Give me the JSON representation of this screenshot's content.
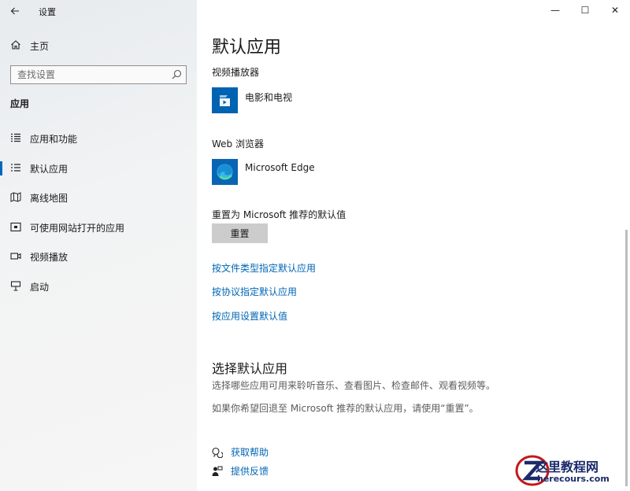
{
  "window": {
    "title": "设置",
    "back_icon": "arrow-left",
    "minimize_glyph": "—",
    "maximize_glyph": "☐",
    "close_glyph": "✕"
  },
  "sidebar": {
    "home_label": "主页",
    "search_placeholder": "查找设置",
    "section_header": "应用",
    "items": [
      {
        "label": "应用和功能",
        "icon": "apps-list-icon",
        "active": false
      },
      {
        "label": "默认应用",
        "icon": "default-apps-icon",
        "active": true
      },
      {
        "label": "离线地图",
        "icon": "map-icon",
        "active": false
      },
      {
        "label": "可使用网站打开的应用",
        "icon": "website-app-icon",
        "active": false
      },
      {
        "label": "视频播放",
        "icon": "video-icon",
        "active": false
      },
      {
        "label": "启动",
        "icon": "startup-icon",
        "active": false
      }
    ]
  },
  "main": {
    "page_title": "默认应用",
    "video_player_label": "视频播放器",
    "video_app_name": "电影和电视",
    "browser_label": "Web 浏览器",
    "browser_app_name": "Microsoft Edge",
    "reset_label": "重置为 Microsoft 推荐的默认值",
    "reset_button": "重置",
    "links": [
      "按文件类型指定默认应用",
      "按协议指定默认应用",
      "按应用设置默认值"
    ],
    "choose_title": "选择默认应用",
    "choose_desc1": "选择哪些应用可用来聆听音乐、查看图片、检查邮件、观看视频等。",
    "choose_desc2": "如果你希望回退至 Microsoft 推荐的默认应用，请使用“重置”。",
    "help_label": "获取帮助",
    "feedback_label": "提供反馈"
  },
  "watermark": {
    "line1": "这里教程网",
    "line2": "herecours.com"
  },
  "colors": {
    "accent": "#0067c0",
    "link": "#0066b4",
    "movies_tile": "#0063b1",
    "edge_tile": "#0a64b4"
  }
}
